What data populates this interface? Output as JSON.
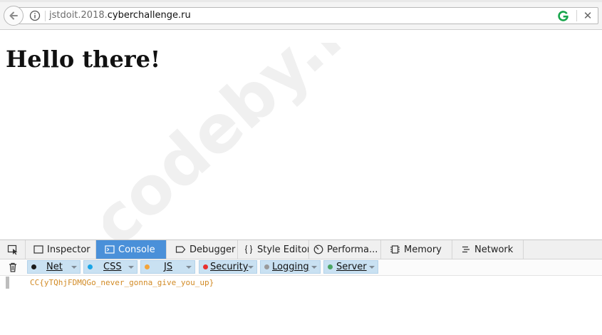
{
  "browser": {
    "url_prefix": "jstdoit.2018.",
    "url_domain": "cyberchallenge.ru",
    "close_glyph": "✕",
    "extension_icon": "grammarly-g-icon",
    "colors": {
      "extension": "#15a54a"
    }
  },
  "page": {
    "heading": "Hello there!",
    "watermark": "codeby.net"
  },
  "devtools": {
    "tabs": [
      {
        "label": "Inspector",
        "icon": "inspector-icon"
      },
      {
        "label": "Console",
        "icon": "console-icon",
        "active": true
      },
      {
        "label": "Debugger",
        "icon": "debugger-icon"
      },
      {
        "label": "Style Editor",
        "icon": "braces-icon"
      },
      {
        "label": "Performa...",
        "icon": "performance-icon"
      },
      {
        "label": "Memory",
        "icon": "memory-icon"
      },
      {
        "label": "Network",
        "icon": "network-icon"
      }
    ],
    "filters": [
      {
        "label": "Net",
        "color": "#1a1a1a"
      },
      {
        "label": "CSS",
        "color": "#1aa5e6"
      },
      {
        "label": "JS",
        "color": "#f3a43a"
      },
      {
        "label": "Security",
        "color": "#e8312f"
      },
      {
        "label": "Logging",
        "color": "#9a9a9a"
      },
      {
        "label": "Server",
        "color": "#4aa564"
      }
    ],
    "colors": {
      "active_tab": "#4a90d9",
      "message": "#d28b26"
    },
    "console": {
      "messages": [
        "CC{yTQhjFDMQGo_never_gonna_give_you_up}"
      ]
    }
  }
}
